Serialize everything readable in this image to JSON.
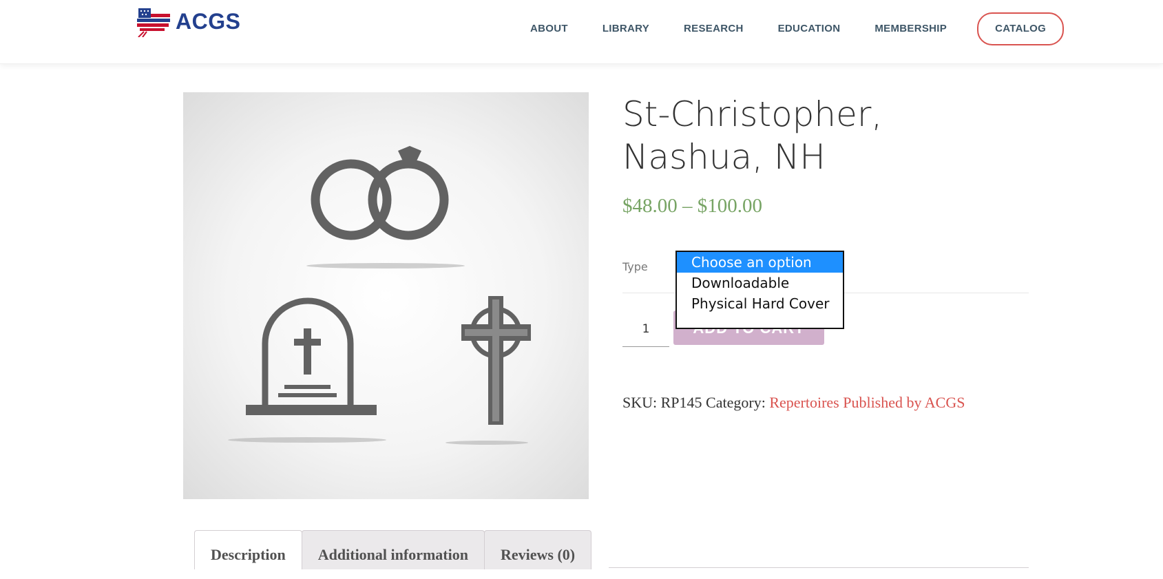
{
  "header": {
    "logo_text": "ACGS",
    "nav": {
      "about": "ABOUT",
      "library": "LIBRARY",
      "research": "RESEARCH",
      "education": "EDUCATION",
      "membership": "MEMBERSHIP",
      "catalog": "CATALOG"
    }
  },
  "product": {
    "title": "St-Christopher, Nashua, NH",
    "price": "$48.00 – $100.00",
    "type_label": "Type",
    "type_options": [
      "Choose an option",
      "Downloadable",
      "Physical Hard Cover"
    ],
    "selected_option": "Choose an option",
    "quantity": "1",
    "add_to_cart_label": "ADD TO CART",
    "sku_label": "SKU:",
    "sku": "RP145",
    "category_label": "Category:",
    "category": "Repertoires Published by ACGS"
  },
  "tabs": [
    "Description",
    "Additional information",
    "Reviews (0)"
  ],
  "colors": {
    "brand_blue": "#23408e",
    "accent_red": "#d9534f",
    "price_green": "#77a464",
    "button_purple": "#c9a3c4",
    "selection_blue": "#1e90ff"
  },
  "icons": {
    "logo": "us-flag-map-icon",
    "image": [
      "wedding-rings-icon",
      "tombstone-icon",
      "celtic-cross-icon"
    ]
  }
}
